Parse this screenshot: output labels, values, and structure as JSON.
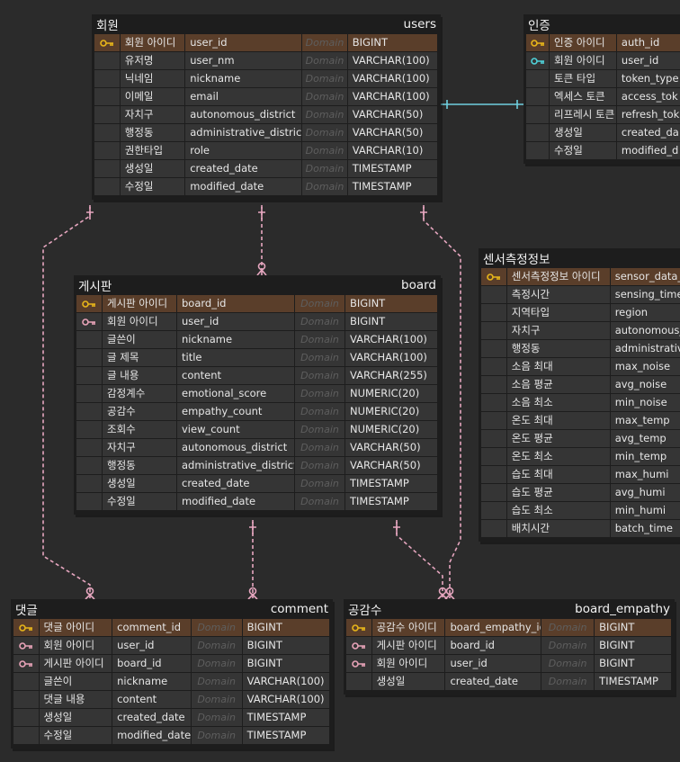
{
  "colors": {
    "background": "#2b2b2b",
    "table_bg": "#1d1d1d",
    "cell_bg": "#353535",
    "pk_row_bg": "#5a3e2a",
    "pk_key": "#e8b61a",
    "fk_key": "#e8a3b8",
    "auth_fk_key": "#4fd1d9",
    "relation_line": "#e6a6bf",
    "auth_relation_line": "#6fd0df"
  },
  "domain_placeholder": "Domain",
  "tables": {
    "users": {
      "logical": "회원",
      "physical": "users",
      "rows": [
        {
          "key": "pk",
          "name": "회원 아이디",
          "col": "user_id",
          "type": "BIGINT"
        },
        {
          "key": "none",
          "name": "유저명",
          "col": "user_nm",
          "type": "VARCHAR(100)"
        },
        {
          "key": "none",
          "name": "닉네임",
          "col": "nickname",
          "type": "VARCHAR(100)"
        },
        {
          "key": "none",
          "name": "이메일",
          "col": "email",
          "type": "VARCHAR(100)"
        },
        {
          "key": "none",
          "name": "자치구",
          "col": "autonomous_district",
          "type": "VARCHAR(50)"
        },
        {
          "key": "none",
          "name": "행정동",
          "col": "administrative_district",
          "type": "VARCHAR(50)"
        },
        {
          "key": "none",
          "name": "권한타입",
          "col": "role",
          "type": "VARCHAR(10)"
        },
        {
          "key": "none",
          "name": "생성일",
          "col": "created_date",
          "type": "TIMESTAMP"
        },
        {
          "key": "none",
          "name": "수정일",
          "col": "modified_date",
          "type": "TIMESTAMP"
        }
      ]
    },
    "auth": {
      "logical": "인증",
      "physical": "",
      "rows": [
        {
          "key": "pk",
          "name": "인증 아이디",
          "col": "auth_id",
          "type": ""
        },
        {
          "key": "fk-cyan",
          "name": "회원 아이디",
          "col": "user_id",
          "type": ""
        },
        {
          "key": "none",
          "name": "토큰 타입",
          "col": "token_type",
          "type": ""
        },
        {
          "key": "none",
          "name": "엑세스 토큰",
          "col": "access_tok",
          "type": ""
        },
        {
          "key": "none",
          "name": "리프레시 토큰",
          "col": "refresh_tok",
          "type": ""
        },
        {
          "key": "none",
          "name": "생성일",
          "col": "created_da",
          "type": ""
        },
        {
          "key": "none",
          "name": "수정일",
          "col": "modified_d",
          "type": ""
        }
      ]
    },
    "board": {
      "logical": "게시판",
      "physical": "board",
      "rows": [
        {
          "key": "pk",
          "name": "게시판 아이디",
          "col": "board_id",
          "type": "BIGINT"
        },
        {
          "key": "fk",
          "name": "회원 아이디",
          "col": "user_id",
          "type": "BIGINT"
        },
        {
          "key": "none",
          "name": "글쓴이",
          "col": "nickname",
          "type": "VARCHAR(100)"
        },
        {
          "key": "none",
          "name": "글 제목",
          "col": "title",
          "type": "VARCHAR(100)"
        },
        {
          "key": "none",
          "name": "글 내용",
          "col": "content",
          "type": "VARCHAR(255)"
        },
        {
          "key": "none",
          "name": "감정계수",
          "col": "emotional_score",
          "type": "NUMERIC(20)"
        },
        {
          "key": "none",
          "name": "공감수",
          "col": "empathy_count",
          "type": "NUMERIC(20)"
        },
        {
          "key": "none",
          "name": "조회수",
          "col": "view_count",
          "type": "NUMERIC(20)"
        },
        {
          "key": "none",
          "name": "자치구",
          "col": "autonomous_district",
          "type": "VARCHAR(50)"
        },
        {
          "key": "none",
          "name": "행정동",
          "col": "administrative_district",
          "type": "VARCHAR(50)"
        },
        {
          "key": "none",
          "name": "생성일",
          "col": "created_date",
          "type": "TIMESTAMP"
        },
        {
          "key": "none",
          "name": "수정일",
          "col": "modified_date",
          "type": "TIMESTAMP"
        }
      ]
    },
    "sensor": {
      "logical": "센서측정정보",
      "physical": "",
      "rows": [
        {
          "key": "pk",
          "name": "센서측정정보 아이디",
          "col": "sensor_data_i",
          "type": ""
        },
        {
          "key": "none",
          "name": "측정시간",
          "col": "sensing_time",
          "type": ""
        },
        {
          "key": "none",
          "name": "지역타입",
          "col": "region",
          "type": ""
        },
        {
          "key": "none",
          "name": "자치구",
          "col": "autonomous_c",
          "type": ""
        },
        {
          "key": "none",
          "name": "행정동",
          "col": "administrative",
          "type": ""
        },
        {
          "key": "none",
          "name": "소음 최대",
          "col": "max_noise",
          "type": ""
        },
        {
          "key": "none",
          "name": "소음 평균",
          "col": "avg_noise",
          "type": ""
        },
        {
          "key": "none",
          "name": "소음 최소",
          "col": "min_noise",
          "type": ""
        },
        {
          "key": "none",
          "name": "온도 최대",
          "col": "max_temp",
          "type": ""
        },
        {
          "key": "none",
          "name": "온도 평균",
          "col": "avg_temp",
          "type": ""
        },
        {
          "key": "none",
          "name": "온도 최소",
          "col": "min_temp",
          "type": ""
        },
        {
          "key": "none",
          "name": "습도 최대",
          "col": "max_humi",
          "type": ""
        },
        {
          "key": "none",
          "name": "습도 평균",
          "col": "avg_humi",
          "type": ""
        },
        {
          "key": "none",
          "name": "습도 최소",
          "col": "min_humi",
          "type": ""
        },
        {
          "key": "none",
          "name": "배치시간",
          "col": "batch_time",
          "type": ""
        }
      ]
    },
    "comment": {
      "logical": "댓글",
      "physical": "comment",
      "rows": [
        {
          "key": "pk",
          "name": "댓글 아이디",
          "col": "comment_id",
          "type": "BIGINT"
        },
        {
          "key": "fk",
          "name": "회원 아이디",
          "col": "user_id",
          "type": "BIGINT"
        },
        {
          "key": "fk",
          "name": "게시판 아이디",
          "col": "board_id",
          "type": "BIGINT"
        },
        {
          "key": "none",
          "name": "글쓴이",
          "col": "nickname",
          "type": "VARCHAR(100)"
        },
        {
          "key": "none",
          "name": "댓글 내용",
          "col": "content",
          "type": "VARCHAR(100)"
        },
        {
          "key": "none",
          "name": "생성일",
          "col": "created_date",
          "type": "TIMESTAMP"
        },
        {
          "key": "none",
          "name": "수정일",
          "col": "modified_date",
          "type": "TIMESTAMP"
        }
      ]
    },
    "board_empathy": {
      "logical": "공감수",
      "physical": "board_empathy",
      "rows": [
        {
          "key": "pk",
          "name": "공감수 아이디",
          "col": "board_empathy_id",
          "type": "BIGINT"
        },
        {
          "key": "fk",
          "name": "게시판 아이디",
          "col": "board_id",
          "type": "BIGINT"
        },
        {
          "key": "fk",
          "name": "회원 아이디",
          "col": "user_id",
          "type": "BIGINT"
        },
        {
          "key": "none",
          "name": "생성일",
          "col": "created_date",
          "type": "TIMESTAMP"
        }
      ]
    }
  }
}
